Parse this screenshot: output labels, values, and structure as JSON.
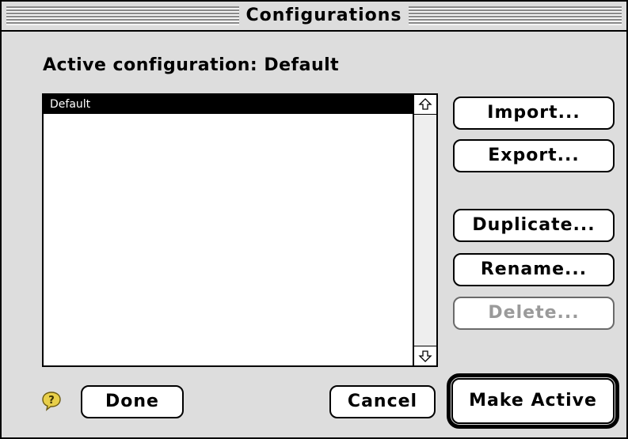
{
  "window": {
    "title": "Configurations"
  },
  "active_configuration_label": "Active configuration: Default",
  "configurations_list": {
    "items": [
      {
        "label": "Default",
        "selected": true
      }
    ]
  },
  "side_buttons": {
    "import": "Import...",
    "export": "Export...",
    "duplicate": "Duplicate...",
    "rename": "Rename...",
    "delete": "Delete..."
  },
  "bottom_buttons": {
    "done": "Done",
    "cancel": "Cancel",
    "make_active": "Make Active"
  },
  "icons": {
    "help": "help-balloon-icon",
    "scroll_up": "scroll-up-arrow-icon",
    "scroll_down": "scroll-down-arrow-icon"
  },
  "colors": {
    "window_bg": "#dddddd",
    "selection_bg": "#000000",
    "selection_text": "#ffffff",
    "disabled_text": "#9a9a9a"
  }
}
